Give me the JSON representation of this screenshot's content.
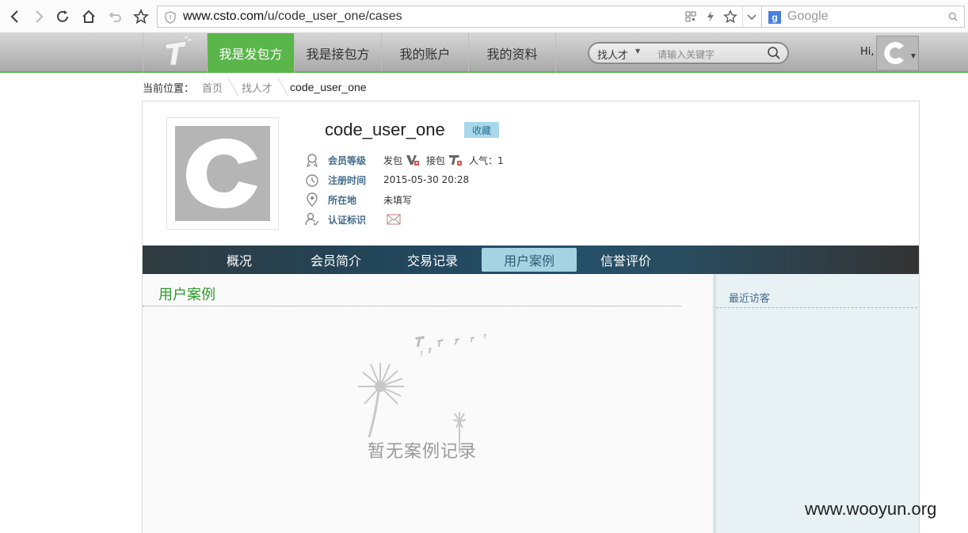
{
  "browser": {
    "url_host": "www.csto.com",
    "url_path": "/u/code_user_one/cases",
    "search_placeholder": "Google"
  },
  "header": {
    "nav": [
      {
        "label": "我是发包方",
        "active": true
      },
      {
        "label": "我是接包方",
        "active": false
      },
      {
        "label": "我的账户",
        "active": false
      },
      {
        "label": "我的资料",
        "active": false
      }
    ],
    "search_category": "找人才",
    "search_placeholder": "请输入关键字",
    "greeting": "Hi,",
    "brand_color": "#5ab54a"
  },
  "breadcrumb": {
    "prefix": "当前位置：",
    "items": [
      "首页",
      "找人才"
    ],
    "current": "code_user_one"
  },
  "profile": {
    "username": "code_user_one",
    "favorite_label": "收藏",
    "level_label": "会员等级",
    "level_send": "发包",
    "level_receive": "接包",
    "popularity": "人气：1",
    "reg_label": "注册时间",
    "reg_value": "2015-05-30 20:28",
    "location_label": "所在地",
    "location_value": "未填写",
    "cert_label": "认证标识"
  },
  "tabs": [
    {
      "label": "概况",
      "active": false
    },
    {
      "label": "会员简介",
      "active": false
    },
    {
      "label": "交易记录",
      "active": false
    },
    {
      "label": "用户案例",
      "active": true
    },
    {
      "label": "信誉评价",
      "active": false
    }
  ],
  "main": {
    "section_title": "用户案例",
    "empty_text": "暂无案例记录"
  },
  "sidebar": {
    "title": "最近访客"
  },
  "watermark": "www.wooyun.org"
}
